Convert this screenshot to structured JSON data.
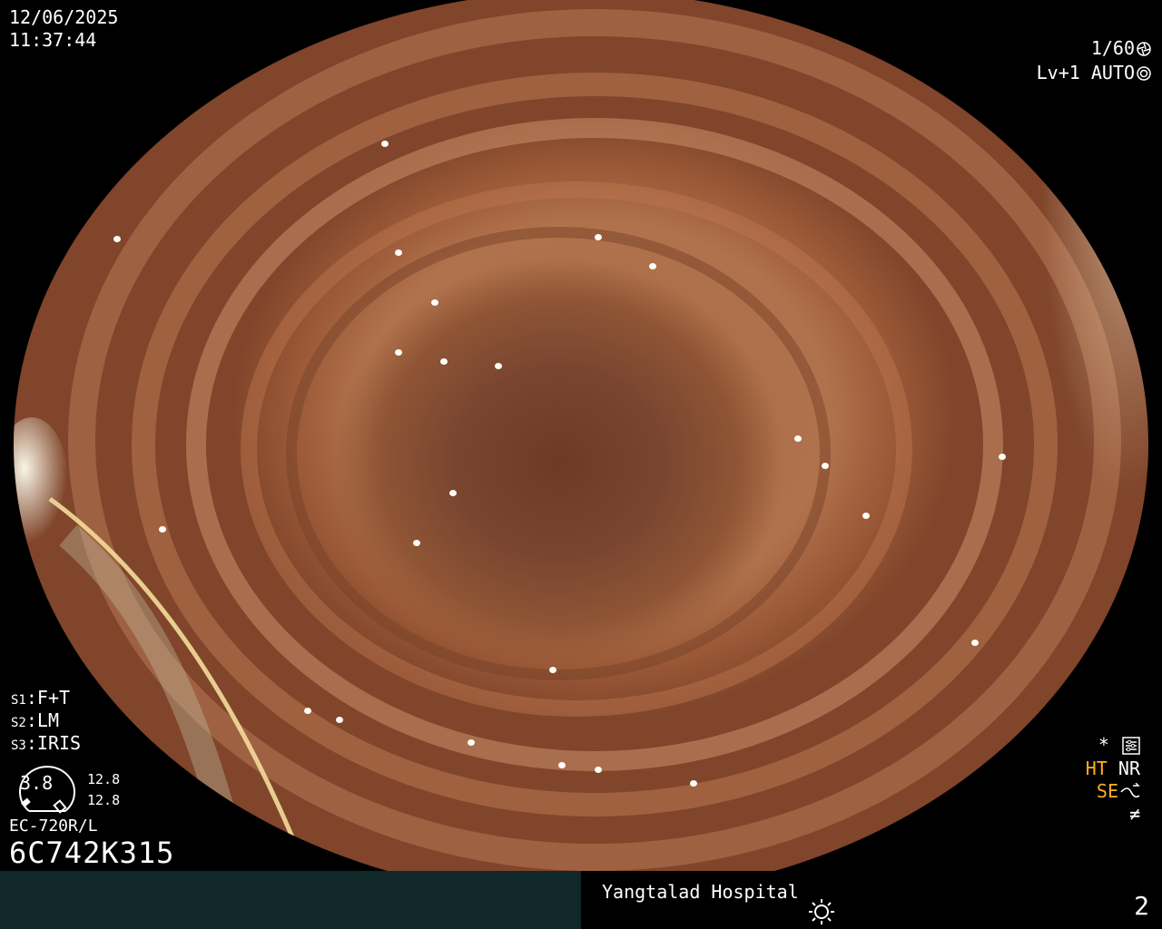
{
  "header": {
    "date": "12/06/2025",
    "time": "11:37:44",
    "shutter": "1/60",
    "shutter_icon": "aperture-icon",
    "level": "Lv+1 AUTO",
    "level_icon": "iris-icon"
  },
  "settings": [
    {
      "key": "S1",
      "value": "F+T"
    },
    {
      "key": "S2",
      "value": "LM"
    },
    {
      "key": "S3",
      "value": "IRIS"
    }
  ],
  "gauge": {
    "value": "3.8",
    "top": "12.8",
    "bottom": "12.8"
  },
  "scope": {
    "model": "EC-720R/L",
    "serial": "6C742K315"
  },
  "status": {
    "star": "*",
    "ht": "HT",
    "nr": "NR",
    "se": "SE",
    "neq": "≠",
    "star_icon": "settings-panel-icon",
    "se_icon": "curve-icon"
  },
  "footer": {
    "hospital": "Yangtalad Hospital",
    "light_icon": "sun-icon",
    "page": "2"
  },
  "colors": {
    "bar_left": "#10282a",
    "highlight": "#ffb020",
    "text": "#ffffff"
  }
}
